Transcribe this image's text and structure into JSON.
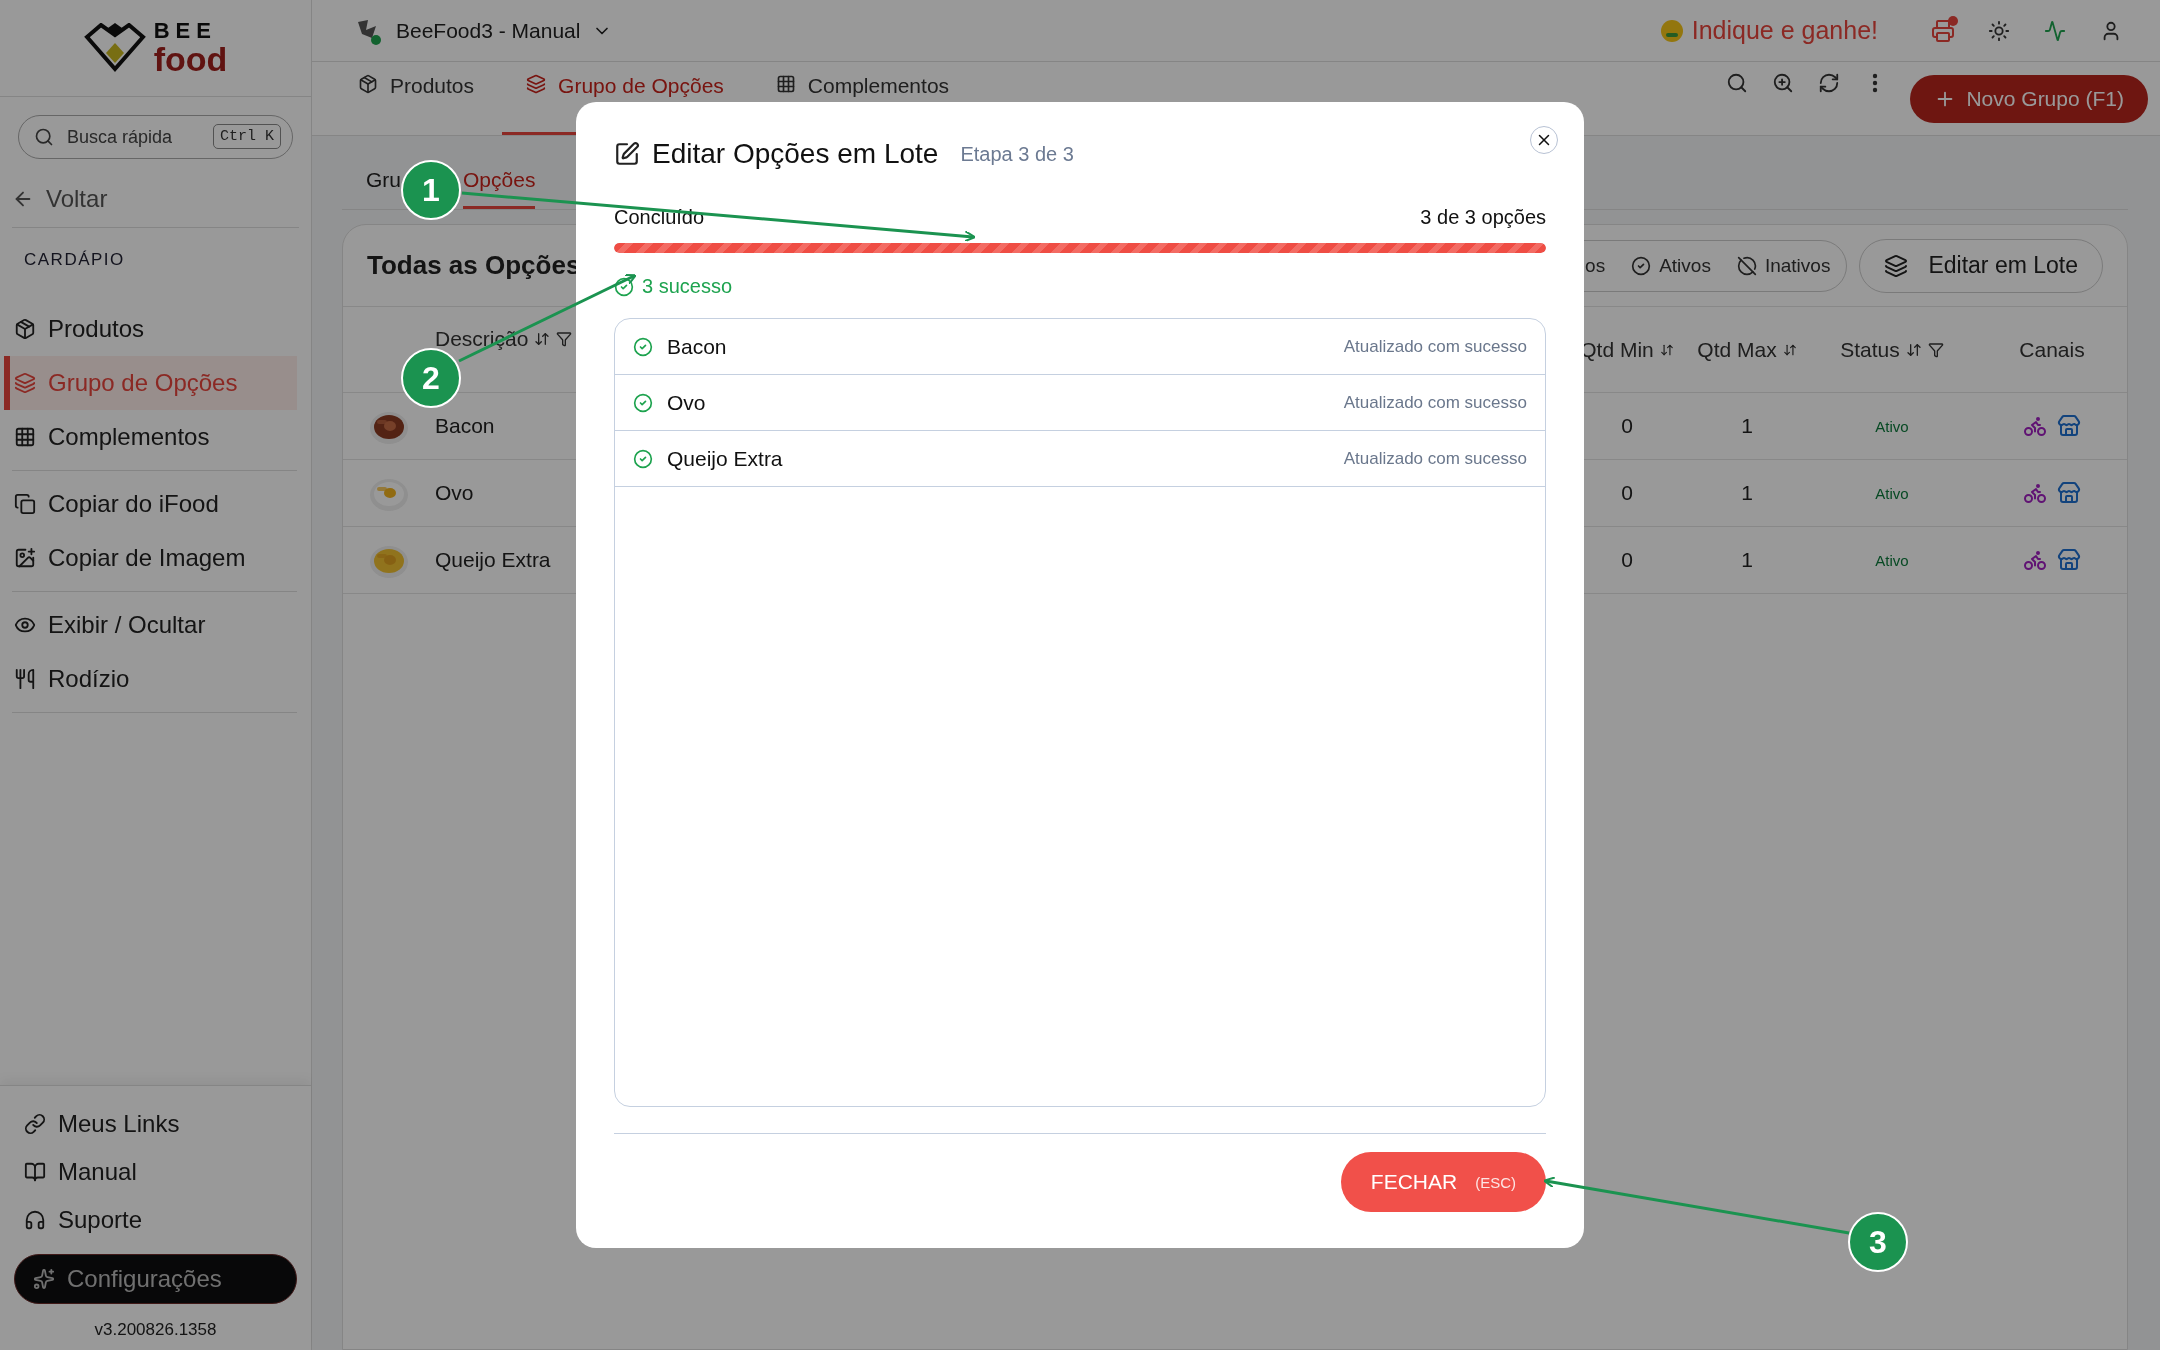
{
  "sidebar": {
    "logo": {
      "top": "BEE",
      "bottom": "food"
    },
    "search": {
      "placeholder": "Busca rápida",
      "shortcut": "Ctrl K"
    },
    "back": "Voltar",
    "section": "CARDÁPIO",
    "groups": [
      [
        {
          "label": "Produtos",
          "selected": false
        },
        {
          "label": "Grupo de Opções",
          "selected": true
        },
        {
          "label": "Complementos",
          "selected": false
        }
      ],
      [
        {
          "label": "Copiar do iFood",
          "selected": false
        },
        {
          "label": "Copiar de Imagem",
          "selected": false
        }
      ],
      [
        {
          "label": "Exibir / Ocultar",
          "selected": false
        },
        {
          "label": "Rodízio",
          "selected": false
        }
      ]
    ],
    "footer_items": [
      {
        "label": "Meus Links"
      },
      {
        "label": "Manual"
      },
      {
        "label": "Suporte"
      }
    ],
    "cta": "Configurações",
    "version": "v3.200826.1358"
  },
  "topbar": {
    "store": "BeeFood3 - Manual",
    "promo": "Indique e ganhe!"
  },
  "tabs": [
    {
      "label": "Produtos",
      "selected": false
    },
    {
      "label": "Grupo de Opções",
      "selected": true
    },
    {
      "label": "Complementos",
      "selected": false
    }
  ],
  "new_button": "Novo Grupo (F1)",
  "subtabs": [
    {
      "label": "Gru",
      "selected": false
    },
    {
      "label": "Opções",
      "selected": true
    }
  ],
  "card": {
    "title": "Todas as Opções",
    "filters": [
      {
        "label": "os",
        "selected": false
      },
      {
        "label": "Ativos",
        "selected": false
      },
      {
        "label": "Inativos",
        "selected": false
      }
    ],
    "batch_button": "Editar em Lote",
    "columns": [
      "Descrição",
      "Qtd Min",
      "Qtd Max",
      "Status",
      "Canais"
    ],
    "rows": [
      {
        "name": "Bacon",
        "min": "0",
        "max": "1",
        "status": "Ativo"
      },
      {
        "name": "Ovo",
        "min": "0",
        "max": "1",
        "status": "Ativo"
      },
      {
        "name": "Queijo Extra",
        "min": "0",
        "max": "1",
        "status": "Ativo"
      }
    ]
  },
  "modal": {
    "title": "Editar Opções em Lote",
    "step": "Etapa 3 de 3",
    "progress_label": "Concluído",
    "progress_count": "3 de 3 opções",
    "level": 1,
    "summary": "3 sucesso",
    "results": [
      {
        "name": "Bacon",
        "message": "Atualizado com sucesso",
        "success": true
      },
      {
        "name": "Ovo",
        "message": "Atualizado com sucesso",
        "success": true
      },
      {
        "name": "Queijo Extra",
        "message": "Atualizado com sucesso",
        "success": true
      }
    ],
    "close_button": "FECHAR",
    "close_shortcut": "(ESC)"
  },
  "callouts": [
    {
      "label": "1"
    },
    {
      "label": "2"
    },
    {
      "label": "3"
    }
  ]
}
